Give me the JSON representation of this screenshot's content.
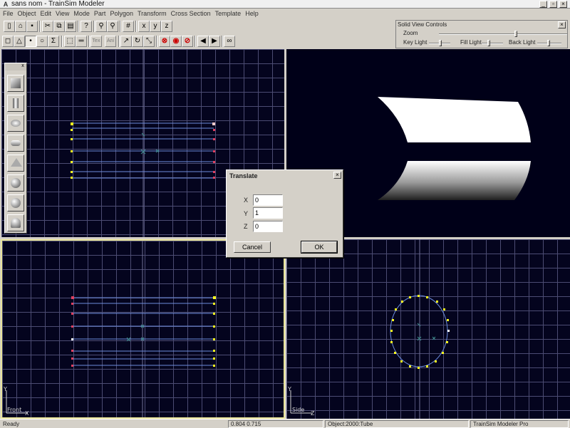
{
  "window": {
    "title": "sans nom - TrainSim Modeler",
    "app_icon": "A",
    "buttons": [
      "minimize-icon",
      "restore-icon",
      "close-icon"
    ]
  },
  "menu": [
    "File",
    "Object",
    "Edit",
    "View",
    "Mode",
    "Part",
    "Polygon",
    "Transform",
    "Cross Section",
    "Template",
    "Help"
  ],
  "toolbar1": [
    "new-icon",
    "open-icon",
    "save-icon",
    "cut-icon",
    "copy-icon",
    "paste-icon",
    "help-icon",
    "zoom-in-icon",
    "zoom-out-icon",
    "grid-icon",
    "snap-x-icon",
    "snap-y-icon",
    "snap-z-icon"
  ],
  "toolbar2": [
    "point-icon",
    "triangle-icon",
    "select-point-icon",
    "select-poly-icon",
    "sigma-icon",
    "select-box-icon",
    "ruler-icon",
    "texture-icon",
    "animate-icon",
    "move-icon",
    "rotate-icon",
    "scale-icon",
    "delete-icon",
    "record-icon",
    "stop-icon",
    "prev-icon",
    "next-icon",
    "binoculars-icon"
  ],
  "toolbar2_text": {
    "tex": "Tex",
    "ani": "Ani",
    "sigma": "Σ"
  },
  "solid_view": {
    "title": "Solid View Controls",
    "zoom": "Zoom",
    "key_light": "Key Light",
    "fill_light": "Fill Light",
    "back_light": "Back Light"
  },
  "palette": {
    "close": "x",
    "tools": [
      "box-tool-icon",
      "cylinder-tool-icon",
      "ellipse-tool-icon",
      "tube-tool-icon",
      "cone-tool-icon",
      "sphere-tool-icon",
      "hemisphere-tool-icon",
      "lathe-tool-icon"
    ]
  },
  "viewports": {
    "front_label": "Front",
    "side_label": "Side",
    "y_axis": "Y",
    "x_axis": "X",
    "z_axis": "Z"
  },
  "dialog": {
    "title": "Translate",
    "x_label": "X",
    "y_label": "Y",
    "z_label": "Z",
    "x_value": "0",
    "y_value": "1",
    "z_value": "0",
    "cancel": "Cancel",
    "ok": "OK"
  },
  "status": {
    "ready": "Ready",
    "coords": "0.804   0.715",
    "object": "Object:2000:Tube",
    "product": "TrainSim Modeler Pro"
  },
  "colors": {
    "viewport_bg": "#04041e",
    "grid": "#4c4c73",
    "wire": "#6b8bdc",
    "vertex_yellow": "#ffff20",
    "vertex_red": "#e04060",
    "active_border": "#e9e49a"
  }
}
